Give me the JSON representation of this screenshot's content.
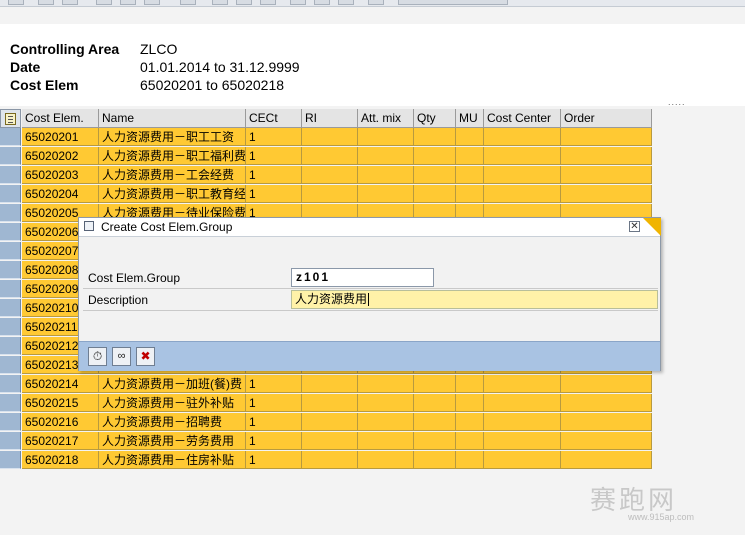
{
  "header": {
    "rows": [
      {
        "label": "Controlling Area",
        "value": "ZLCO"
      },
      {
        "label": "Date",
        "value": "01.01.2014 to 31.12.9999"
      },
      {
        "label": "Cost Elem",
        "value": "65020201 to 65020218"
      }
    ]
  },
  "grid": {
    "columns": [
      {
        "key": "cost_elem",
        "label": "Cost Elem."
      },
      {
        "key": "name",
        "label": "Name"
      },
      {
        "key": "cect",
        "label": "CECt"
      },
      {
        "key": "ri",
        "label": "RI"
      },
      {
        "key": "att_mix",
        "label": "Att. mix"
      },
      {
        "key": "qty",
        "label": "Qty"
      },
      {
        "key": "mu",
        "label": "MU"
      },
      {
        "key": "cost_center",
        "label": "Cost Center"
      },
      {
        "key": "order",
        "label": "Order"
      }
    ],
    "rows": [
      {
        "cost_elem": "65020201",
        "name": "人力资源费用－职工工资",
        "cect": "1"
      },
      {
        "cost_elem": "65020202",
        "name": "人力资源费用－职工福利费",
        "cect": "1"
      },
      {
        "cost_elem": "65020203",
        "name": "人力资源费用－工会经费",
        "cect": "1"
      },
      {
        "cost_elem": "65020204",
        "name": "人力资源费用－职工教育经",
        "cect": "1"
      },
      {
        "cost_elem": "65020205",
        "name": "人力资源费用－待业保险费",
        "cect": "1"
      },
      {
        "cost_elem": "65020206",
        "name": "",
        "cect": ""
      },
      {
        "cost_elem": "65020207",
        "name": "",
        "cect": ""
      },
      {
        "cost_elem": "65020208",
        "name": "",
        "cect": ""
      },
      {
        "cost_elem": "65020209",
        "name": "",
        "cect": ""
      },
      {
        "cost_elem": "65020210",
        "name": "",
        "cect": ""
      },
      {
        "cost_elem": "65020211",
        "name": "",
        "cect": ""
      },
      {
        "cost_elem": "65020212",
        "name": "",
        "cect": ""
      },
      {
        "cost_elem": "65020213",
        "name": "",
        "cect": ""
      },
      {
        "cost_elem": "65020214",
        "name": "人力资源费用－加班(餐)费",
        "cect": "1"
      },
      {
        "cost_elem": "65020215",
        "name": "人力资源费用－驻外补贴",
        "cect": "1"
      },
      {
        "cost_elem": "65020216",
        "name": "人力资源费用－招聘费",
        "cect": "1"
      },
      {
        "cost_elem": "65020217",
        "name": "人力资源费用－劳务费用",
        "cect": "1"
      },
      {
        "cost_elem": "65020218",
        "name": "人力资源费用－住房补贴",
        "cect": "1"
      }
    ]
  },
  "dialog": {
    "title": "Create Cost Elem.Group",
    "close_glyph": "✕",
    "group_label": "Cost Elem.Group",
    "group_value": "z101",
    "description_label": "Description",
    "description_value": "人力资源费用",
    "buttons": [
      {
        "name": "execute-button",
        "glyph": "⏱"
      },
      {
        "name": "glasses-button",
        "glyph": "∞"
      },
      {
        "name": "cancel-button",
        "glyph": "✖"
      }
    ]
  },
  "watermark": {
    "text": "赛跑网",
    "sub": "www.915ap.com"
  },
  "colors": {
    "row_fill": "#ffc933",
    "selector_col": "#9fb7d2",
    "dialog_footer": "#a9c3e3",
    "description_field": "#fff2a8"
  }
}
